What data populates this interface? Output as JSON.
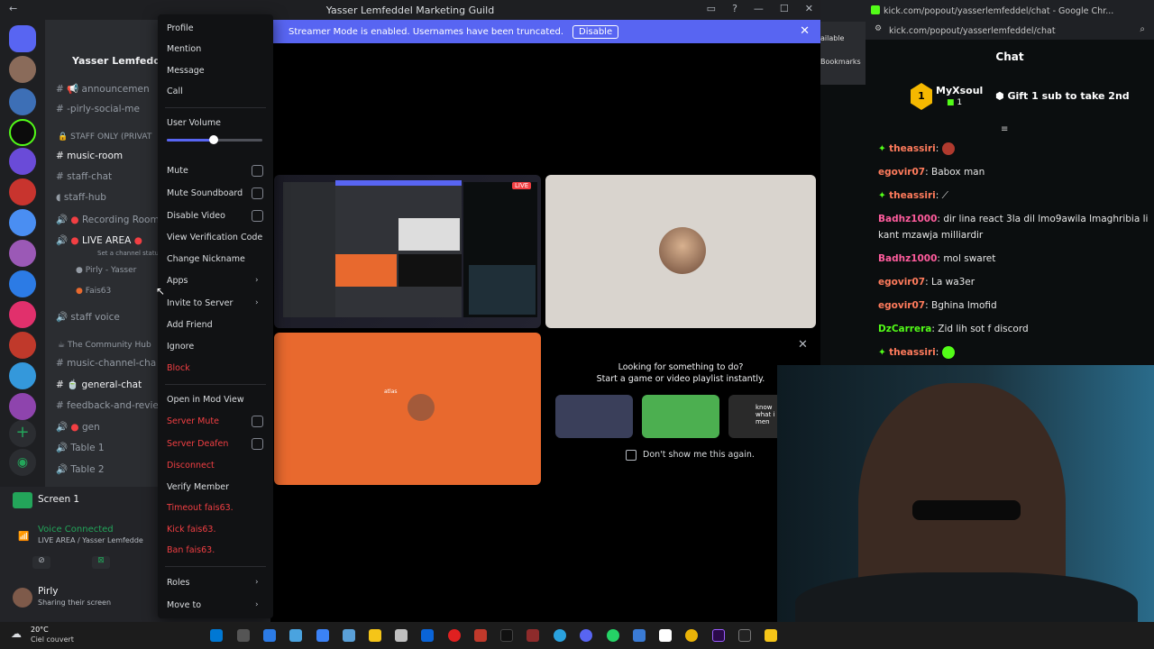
{
  "discord": {
    "window_title": "Yasser Lemfeddel Marketing Guild",
    "guild_name": "Yasser Lemfeddel M",
    "streamer_banner": {
      "text": "Streamer Mode is enabled. Usernames have been truncated.",
      "disable_label": "Disable"
    },
    "channels": [
      {
        "label": "announcemen"
      },
      {
        "label": "-pirly-social-me"
      },
      {
        "label": "STAFF ONLY (PRIVAT"
      },
      {
        "label": "music-room"
      },
      {
        "label": "staff-chat"
      },
      {
        "label": "staff-hub"
      },
      {
        "label": "Recording Room"
      },
      {
        "label": "LIVE AREA"
      },
      {
        "label": "Set a channel status"
      },
      {
        "label": "Pirly - Yasser"
      },
      {
        "label": "Fais63"
      },
      {
        "label": "staff voice"
      },
      {
        "label": "The Community Hub"
      },
      {
        "label": "music-channel-cha"
      },
      {
        "label": "general-chat"
      },
      {
        "label": "feedback-and-revie"
      },
      {
        "label": "gen"
      },
      {
        "label": "Table 1"
      },
      {
        "label": "Table 2"
      }
    ],
    "screen_share_label": "Screen 1",
    "voice": {
      "status": "Voice Connected",
      "location": "LIVE AREA / Yasser Lemfedde"
    },
    "user": {
      "name": "Pirly",
      "status": "Sharing their screen"
    },
    "activity": {
      "title": "Looking for something to do?",
      "subtitle": "Start a game or video playlist instantly.",
      "checkbox_label": "Don't show me this again.",
      "card3_text": "know what i men"
    },
    "orange_tile_text": "atlas"
  },
  "context_menu": {
    "items": [
      "Profile",
      "Mention",
      "Message",
      "Call",
      "User Volume",
      "Mute",
      "Mute Soundboard",
      "Disable Video",
      "View Verification Code",
      "Change Nickname",
      "Apps",
      "Invite to Server",
      "Add Friend",
      "Ignore",
      "Block",
      "Open in Mod View",
      "Server Mute",
      "Server Deafen",
      "Disconnect",
      "Verify Member",
      "Timeout fais63.",
      "Kick fais63.",
      "Ban fais63.",
      "Roles",
      "Move to"
    ],
    "volume_level": 0.49
  },
  "kick": {
    "window_title": "kick.com/popout/yasserlemfeddel/chat - Google Chr...",
    "url": "kick.com/popout/yasserlemfeddel/chat",
    "side_labels": {
      "available": "ailable",
      "bookmarks": "Bookmarks"
    },
    "chat_title": "Chat",
    "pinned": {
      "rank": "1",
      "user": "MyXsoul",
      "count": "1",
      "text": "Gift 1 sub to take 2nd"
    },
    "messages": [
      {
        "user": "theassiri",
        "text": "",
        "color": "#ff7b5c"
      },
      {
        "user": "egovir07",
        "text": "Babox man",
        "color": "#ff7b5c"
      },
      {
        "user": "theassiri",
        "text": "",
        "color": "#ff7b5c"
      },
      {
        "user": "Badhz1000",
        "text": "dir lina react 3la dil lmo9awila lmaghribia li kant mzawja milliardir",
        "color": "#ff5c9d"
      },
      {
        "user": "Badhz1000",
        "text": "mol swaret",
        "color": "#ff5c9d"
      },
      {
        "user": "egovir07",
        "text": "La wa3er",
        "color": "#ff7b5c"
      },
      {
        "user": "egovir07",
        "text": "Bghina lmofid",
        "color": "#ff7b5c"
      },
      {
        "user": "DzCarrera",
        "text": "Zid lih sot f discord",
        "color": "#53fc18"
      },
      {
        "user": "theassiri",
        "text": "",
        "color": "#ff7b5c"
      }
    ]
  },
  "taskbar": {
    "weather_temp": "20°C",
    "weather_desc": "Ciel couvert"
  },
  "colors": {
    "discord_blurple": "#5865f2",
    "danger_red": "#f23f43",
    "kick_green": "#53fc18",
    "orange_tile": "#e8692e"
  }
}
